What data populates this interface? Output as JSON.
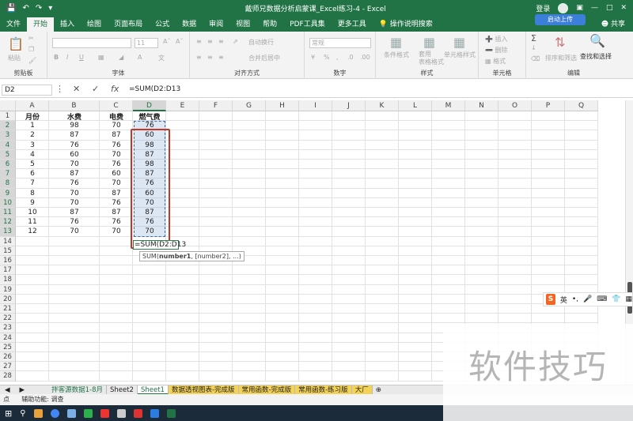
{
  "titlebar": {
    "title": "戴师兄数据分析启蒙课_Excel练习-4  -  Excel",
    "search_hint": "",
    "login": "登录",
    "save_icon": "save-icon",
    "undo_icon": "undo-icon",
    "redo_icon": "redo-icon"
  },
  "ribbon_tabs": [
    "文件",
    "开始",
    "插入",
    "绘图",
    "页面布局",
    "公式",
    "数据",
    "审阅",
    "视图",
    "帮助",
    "PDF工具集",
    "更多工具",
    "操作说明搜索"
  ],
  "active_tab": "开始",
  "share_label": "共享",
  "upload_label": "启动上传",
  "ribbon": {
    "clipboard": {
      "label": "剪贴板",
      "paste": "粘贴"
    },
    "font": {
      "label": "字体",
      "size": "11"
    },
    "alignment": {
      "label": "对齐方式",
      "wrap": "自动换行",
      "merge": "合并后居中"
    },
    "number": {
      "label": "数字",
      "format": "常规"
    },
    "styles": {
      "label": "样式",
      "cond": "条件格式",
      "table": "套用\n表格格式",
      "cell": "单元格样式"
    },
    "cells": {
      "label": "单元格",
      "insert": "插入",
      "delete": "删除",
      "format": "格式"
    },
    "editing": {
      "label": "编辑",
      "sort": "排序和筛选",
      "find": "查找和选择"
    }
  },
  "formula_bar": {
    "name_box": "D2",
    "formula": "=SUM(D2:D13",
    "cancel_icon": "x-icon",
    "enter_icon": "check-icon",
    "fx": "fx"
  },
  "columns": [
    "A",
    "B",
    "C",
    "D",
    "E",
    "F",
    "G",
    "H",
    "I",
    "J",
    "K",
    "L",
    "M",
    "N",
    "O",
    "P",
    "Q"
  ],
  "rows": [
    "1",
    "2",
    "3",
    "4",
    "5",
    "6",
    "7",
    "8",
    "9",
    "10",
    "11",
    "12",
    "13",
    "14",
    "15",
    "16",
    "17",
    "18",
    "19",
    "20",
    "21",
    "22",
    "23",
    "24",
    "25",
    "26",
    "27",
    "28"
  ],
  "table": {
    "headers": [
      "月份",
      "水费",
      "电费",
      "燃气费"
    ],
    "rows": [
      [
        "1",
        "98",
        "70",
        "76"
      ],
      [
        "2",
        "87",
        "87",
        "60"
      ],
      [
        "3",
        "76",
        "76",
        "98"
      ],
      [
        "4",
        "60",
        "70",
        "87"
      ],
      [
        "5",
        "70",
        "76",
        "98"
      ],
      [
        "6",
        "87",
        "60",
        "87"
      ],
      [
        "7",
        "76",
        "70",
        "76"
      ],
      [
        "8",
        "70",
        "87",
        "60"
      ],
      [
        "9",
        "70",
        "76",
        "70"
      ],
      [
        "10",
        "87",
        "87",
        "87"
      ],
      [
        "11",
        "76",
        "76",
        "76"
      ],
      [
        "12",
        "70",
        "70",
        "70"
      ]
    ]
  },
  "editing_cell": "=SUM(D2:D13",
  "tooltip": {
    "prefix": "SUM(",
    "arg1": "number1",
    "rest": ", [number2], ...)"
  },
  "sheet_tabs": [
    "拌客源数据1-8月",
    "Sheet2",
    "Sheet1",
    "数据透视图表-完成版",
    "常用函数-完成版",
    "常用函数-练习版",
    "大厂"
  ],
  "active_sheet": "Sheet1",
  "status": {
    "mode": "点",
    "accessibility": "辅助功能: 调查"
  },
  "ime": {
    "lang": "英"
  },
  "watermark": "软件技巧"
}
